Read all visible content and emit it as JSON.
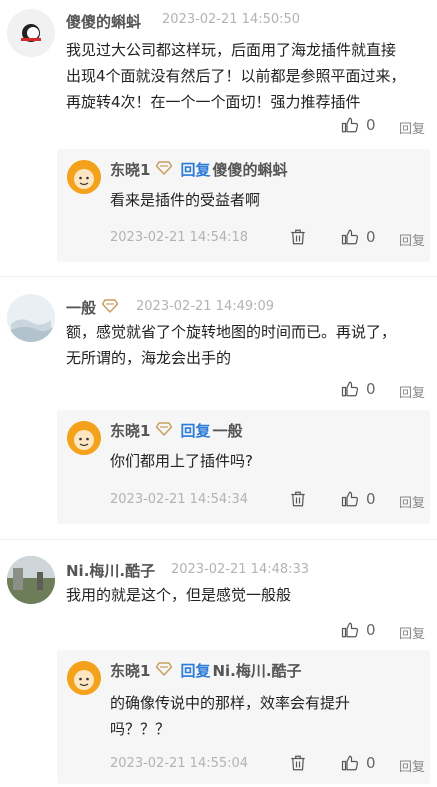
{
  "comments": [
    {
      "user": "傻傻的蝌蚪",
      "time": "2023-02-21 14:50:50",
      "text_lines": [
        "我见过大公司都这样玩，后面用了海龙插件就直接",
        "出现4个面就没有然后了！以前都是参照平面过来，",
        "再旋转4次！在一个一个面切！强力推荐插件"
      ],
      "likes": "0",
      "report": "回复",
      "reply": {
        "user": "东晓1",
        "reply_word": "回复",
        "target": "傻傻的蝌蚪",
        "text_lines": [
          "看来是插件的受益者啊"
        ],
        "time": "2023-02-21 14:54:18",
        "likes": "0",
        "report": "回复"
      }
    },
    {
      "user": "一般",
      "time": "2023-02-21 14:49:09",
      "text_lines": [
        "额，感觉就省了个旋转地图的时间而已。再说了，",
        "无所谓的，海龙会出手的"
      ],
      "likes": "0",
      "report": "回复",
      "reply": {
        "user": "东晓1",
        "reply_word": "回复",
        "target": "一般",
        "text_lines": [
          "你们都用上了插件吗?"
        ],
        "time": "2023-02-21 14:54:34",
        "likes": "0",
        "report": "回复"
      }
    },
    {
      "user": "Ni.梅川.酷子",
      "time": "2023-02-21 14:48:33",
      "text_lines": [
        "我用的就是这个，但是感觉一般般"
      ],
      "likes": "0",
      "report": "回复",
      "reply": {
        "user": "东晓1",
        "reply_word": "回复",
        "target": "Ni.梅川.酷子",
        "text_lines": [
          "的确像传说中的那样，效率会有提升",
          "吗？？？"
        ],
        "time": "2023-02-21 14:55:04",
        "likes": "0",
        "report": "回复"
      }
    }
  ],
  "colors": {
    "reply_link": "#2b7bd8",
    "badge": "#c8a060",
    "meta": "#b3b3b3"
  },
  "icons": [
    "thumbs-up-icon",
    "trash-icon",
    "badge-icon"
  ]
}
